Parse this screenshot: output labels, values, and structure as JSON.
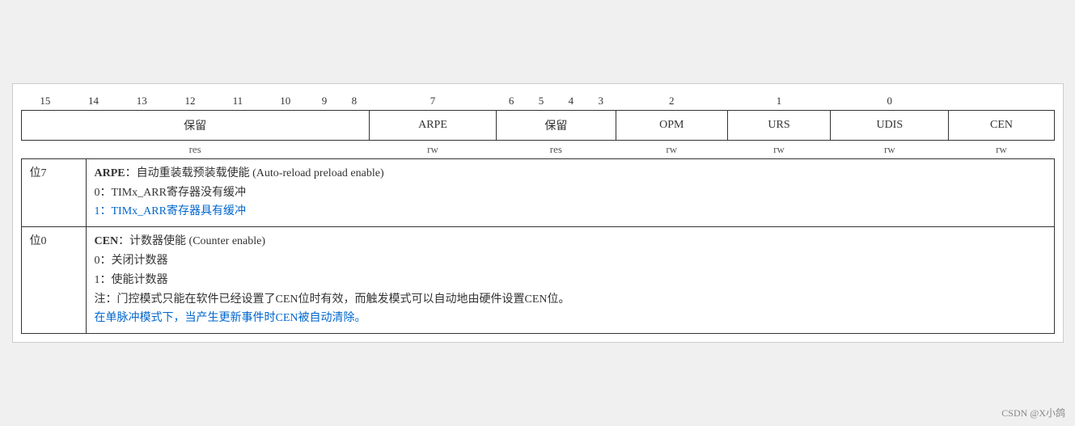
{
  "register": {
    "bit_numbers": [
      "15",
      "14",
      "13",
      "12",
      "11",
      "10",
      "9",
      "8",
      "7",
      "6",
      "5",
      "4",
      "3",
      "2",
      "1",
      "0"
    ],
    "cells": [
      {
        "label": "保留",
        "colspan": 8,
        "rw": "res"
      },
      {
        "label": "ARPE",
        "colspan": 1,
        "rw": "rw"
      },
      {
        "label": "保留",
        "colspan": 4,
        "rw": "res"
      },
      {
        "label": "OPM",
        "colspan": 1,
        "rw": "rw"
      },
      {
        "label": "URS",
        "colspan": 1,
        "rw": "rw"
      },
      {
        "label": "UDIS",
        "colspan": 1,
        "rw": "rw"
      },
      {
        "label": "CEN",
        "colspan": 1,
        "rw": "rw"
      }
    ]
  },
  "descriptions": [
    {
      "bit_label": "位7",
      "title_bold": "ARPE",
      "title_rest": "：自动重装载预装载使能 (Auto-reload preload enable)",
      "lines": [
        "0：TIMx_ARR寄存器没有缓冲",
        {
          "text": "1：TIMx_ARR寄存器具有缓冲",
          "highlight": true
        }
      ]
    },
    {
      "bit_label": "位0",
      "title_bold": "CEN",
      "title_rest": "：计数器使能 (Counter enable)",
      "lines": [
        "0：关闭计数器",
        "1：使能计数器",
        "注：门控模式只能在软件已经设置了CEN位时有效，而触发模式可以自动地由硬件设置CEN位。",
        {
          "text": "在单脉冲模式下，当产生更新事件时CEN被自动清除。",
          "highlight": true
        }
      ]
    }
  ],
  "watermark": "CSDN @X小鸽"
}
